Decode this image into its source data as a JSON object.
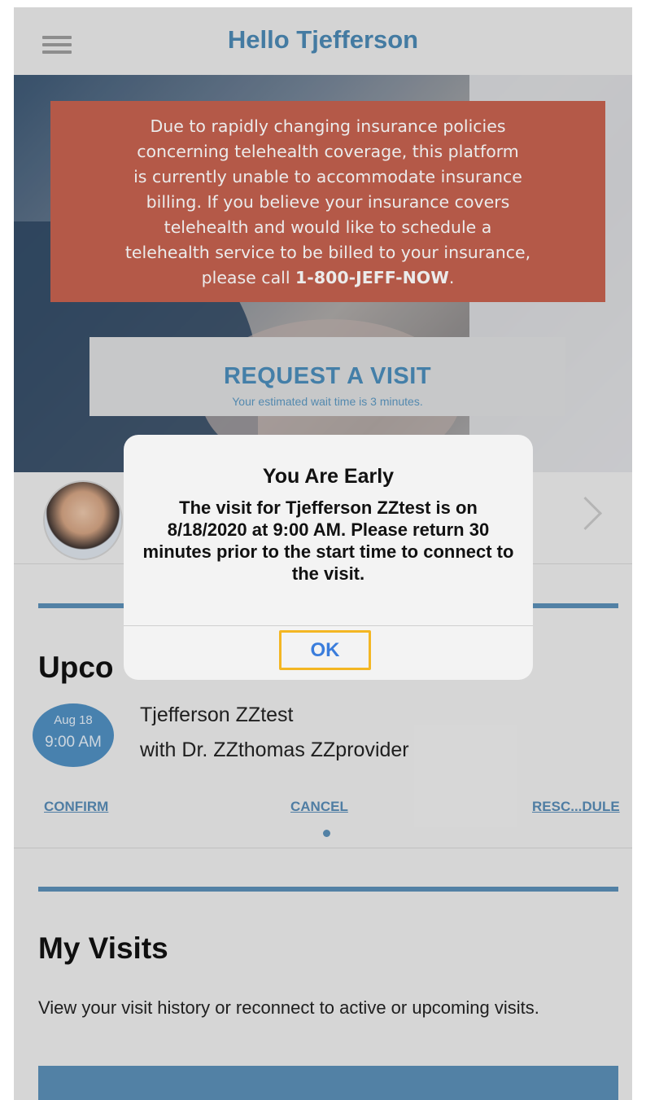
{
  "header": {
    "title": "Hello Tjefferson"
  },
  "notice": {
    "lines": [
      "Due to rapidly changing insurance policies",
      "concerning telehealth coverage, this platform",
      "is currently unable to accommodate insurance",
      "billing. If you believe your insurance covers",
      "telehealth and would like to schedule a",
      "telehealth service to be billed to your insurance,"
    ],
    "call_prefix": "please call ",
    "phone": "1-800-JEFF-NOW",
    "call_suffix": "."
  },
  "request": {
    "label": "REQUEST A VISIT",
    "wait_text": "Your estimated wait time is 3 minutes."
  },
  "upcoming": {
    "heading": "Upco",
    "date_month_day": "Aug 18",
    "time": "9:00 AM",
    "patient": "Tjefferson ZZtest",
    "provider": "with Dr. ZZthomas ZZprovider",
    "confirm_label": "CONFIRM",
    "cancel_label": "CANCEL",
    "reschedule_label": "RESC...DULE"
  },
  "my_visits": {
    "heading": "My Visits",
    "description": "View your visit history or reconnect to active or upcoming visits."
  },
  "alert": {
    "title": "You Are Early",
    "message": "The visit for Tjefferson ZZtest is on 8/18/2020 at 9:00 AM. Please return 30 minutes prior to the start time to connect to the visit.",
    "ok_label": "OK"
  },
  "colors": {
    "accent": "#4a86b0",
    "notice_bg": "#c4614f",
    "ok_highlight": "#f3b623"
  }
}
